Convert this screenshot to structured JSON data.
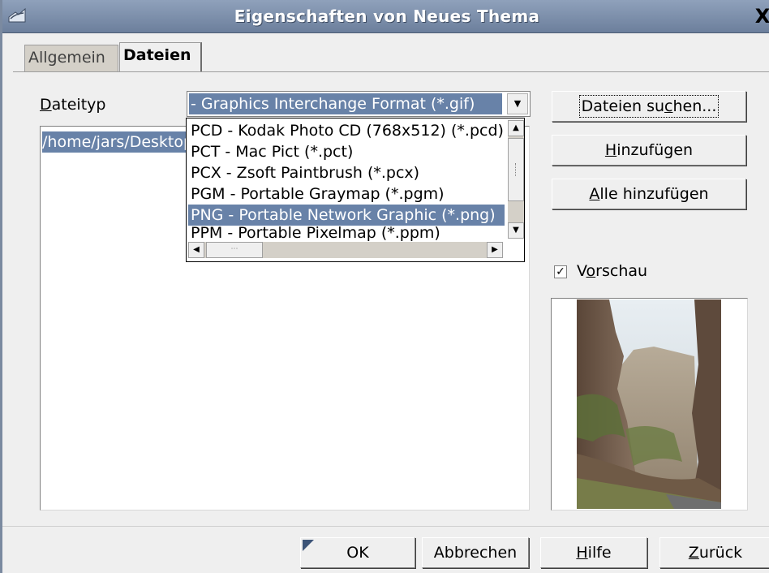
{
  "window": {
    "title": "Eigenschaften von Neues Thema",
    "close_glyph": "X"
  },
  "tabs": [
    {
      "label": "Allgemein",
      "active": false
    },
    {
      "label": "Dateien",
      "active": true
    }
  ],
  "filetype": {
    "label_mnemonic": "D",
    "label_rest": "ateityp",
    "selected_value": "- Graphics Interchange Format (*.gif)",
    "options": [
      "PCD - Kodak Photo CD (768x512) (*.pcd)",
      "PCT - Mac Pict (*.pct)",
      "PCX - Zsoft Paintbrush (*.pcx)",
      "PGM - Portable Graymap (*.pgm)",
      "PNG - Portable Network Graphic (*.png)",
      "PPM - Portable Pixelmap (*.ppm)"
    ],
    "selected_option_index": 4
  },
  "file_list": {
    "items": [
      "/home/jars/Desktop"
    ]
  },
  "side_buttons": {
    "search_pre": "Dateien su",
    "search_mnemonic": "c",
    "search_post": "hen...",
    "add_mnemonic": "H",
    "add_rest": "inzufügen",
    "addall_mnemonic": "A",
    "addall_rest": "lle hinzufügen"
  },
  "preview": {
    "checkbox_checked": true,
    "checkmark": "✓",
    "label_pre": "V",
    "label_mnemonic": "o",
    "label_post": "rschau"
  },
  "footer_buttons": {
    "ok": "OK",
    "cancel": "Abbrechen",
    "help_mnemonic": "H",
    "help_rest": "ilfe",
    "back_mnemonic": "Z",
    "back_rest": "urück"
  },
  "colors": {
    "titlebar": "#7b8eab",
    "selection": "#6882a8",
    "dialog_bg": "#efefef"
  }
}
